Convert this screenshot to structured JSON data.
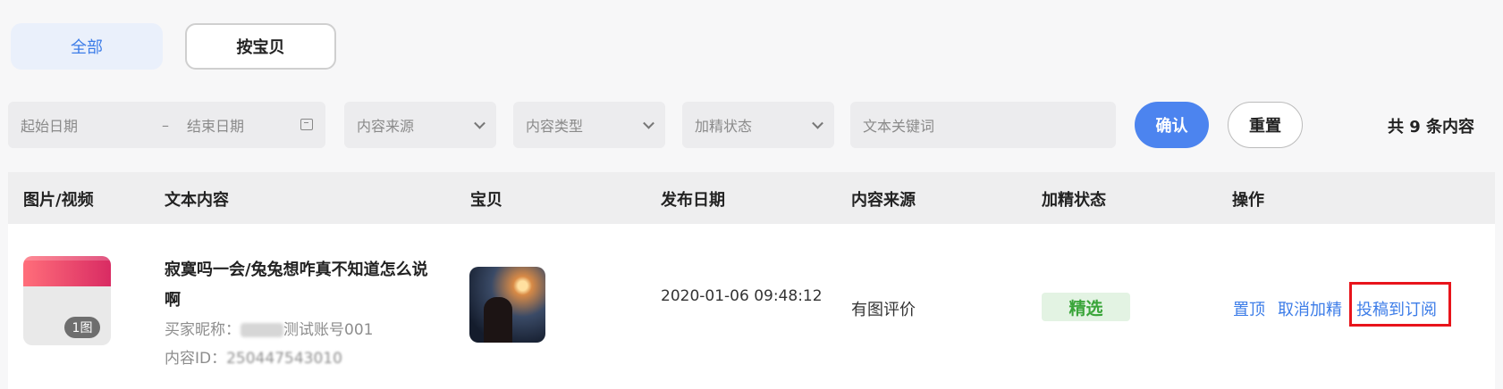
{
  "tabs": [
    {
      "label": "全部"
    },
    {
      "label": "按宝贝"
    }
  ],
  "filters": {
    "start_date_placeholder": "起始日期",
    "separator": "–",
    "end_date_placeholder": "结束日期",
    "content_source": "内容来源",
    "content_type": "内容类型",
    "featured_status": "加精状态",
    "keyword_placeholder": "文本关键词"
  },
  "buttons": {
    "confirm": "确认",
    "reset": "重置"
  },
  "total": "共 9 条内容",
  "table": {
    "headers": [
      "图片/视频",
      "文本内容",
      "宝贝",
      "发布日期",
      "内容来源",
      "加精状态",
      "操作"
    ],
    "rows": [
      {
        "media_count": "1图",
        "text": "寂寞吗一会/兔兔想咋真不知道怎么说啊",
        "buyer_nick_label": "买家昵称：",
        "buyer_nick_suffix": "测试账号001",
        "content_id_label": "内容ID：",
        "content_id_value": "250447543010",
        "publish_date": "2020-01-06 09:48:12",
        "source": "有图评价",
        "status": "精选",
        "actions": [
          "置顶",
          "取消加精",
          "投稿到订阅"
        ]
      }
    ]
  },
  "colors": {
    "accent": "#3d7de8",
    "confirm_bg": "#4c84ef",
    "featured": "#3aa53a",
    "highlight": "#e8141b"
  }
}
